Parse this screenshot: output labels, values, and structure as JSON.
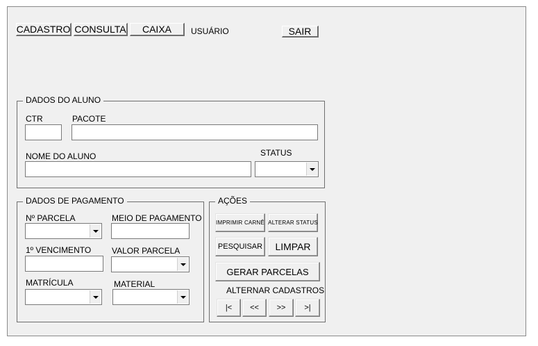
{
  "top_menu": {
    "cadastro": "CADASTRO",
    "consulta": "CONSULTA",
    "caixa": "CAIXA",
    "usuario": "USUÁRIO",
    "sair": "SAIR"
  },
  "dados_aluno": {
    "title": "DADOS DO ALUNO",
    "ctr_label": "CTR",
    "pacote_label": "PACOTE",
    "nome_label": "NOME DO ALUNO",
    "status_label": "STATUS",
    "ctr_value": "",
    "pacote_value": "",
    "nome_value": "",
    "status_value": ""
  },
  "dados_pagamento": {
    "title": "DADOS DE PAGAMENTO",
    "parcela_label": "Nº PARCELA",
    "meio_label": "MEIO DE PAGAMENTO",
    "vencimento_label": "1º VENCIMENTO",
    "valor_label": "VALOR PARCELA",
    "matricula_label": "MATRÍCULA",
    "material_label": "MATERIAL"
  },
  "acoes": {
    "title": "AÇÕES",
    "imprimir_carne": "IMPRIMIR CARNÊ",
    "alterar_status": "ALTERAR STATUS",
    "pesquisar": "PESQUISAR",
    "limpar": "LIMPAR",
    "gerar_parcelas": "GERAR PARCELAS",
    "alternar_label": "ALTERNAR CADASTROS",
    "first": "|<",
    "prev": "<<",
    "next": ">>",
    "last": ">|"
  }
}
